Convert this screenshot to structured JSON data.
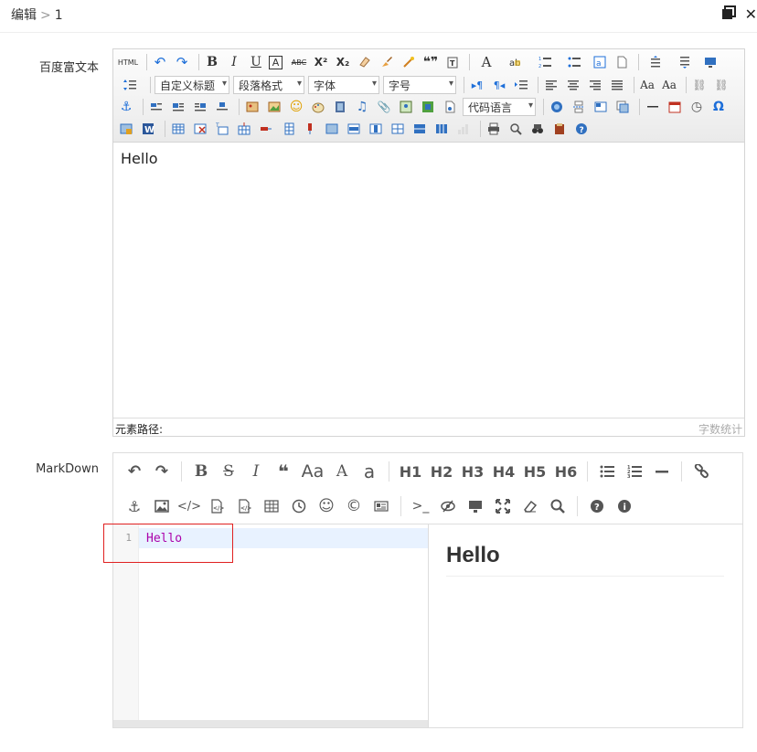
{
  "breadcrumb": {
    "section": "编辑",
    "separator": ">",
    "id": "1"
  },
  "fields": {
    "rich_label": "百度富文本",
    "markdown_label": "MarkDown"
  },
  "ueditor": {
    "toolbar": {
      "html_label": "HTML",
      "custom_title": "自定义标题",
      "paragraph_format": "段落格式",
      "font_family": "字体",
      "font_size": "字号",
      "code_language": "代码语言",
      "bold": "B",
      "italic": "I",
      "underline": "U",
      "font_border": "A",
      "strikethrough": "ABC",
      "superscript": "X²",
      "subscript": "X₂",
      "fore_color": "A",
      "quote": "❝❞",
      "line_height_glyph": "Ω"
    },
    "content": "Hello",
    "status_path": "元素路径:",
    "status_count": "字数统计"
  },
  "markdown": {
    "toolbar_row1": [
      "↶",
      "↷",
      "B",
      "S",
      "I",
      "❝",
      "Aa",
      "A",
      "a",
      "H1",
      "H2",
      "H3",
      "H4",
      "H5",
      "H6"
    ],
    "code_line_number": "1",
    "code_text": "Hello",
    "preview_h1": "Hello"
  },
  "colors": {
    "accent": "#1e6fd9",
    "highlight_box": "#e02020",
    "code_text": "#aa00aa",
    "active_line": "#e8f2ff"
  },
  "icons": {
    "top_right": [
      "restore-window-icon",
      "close-icon"
    ]
  }
}
